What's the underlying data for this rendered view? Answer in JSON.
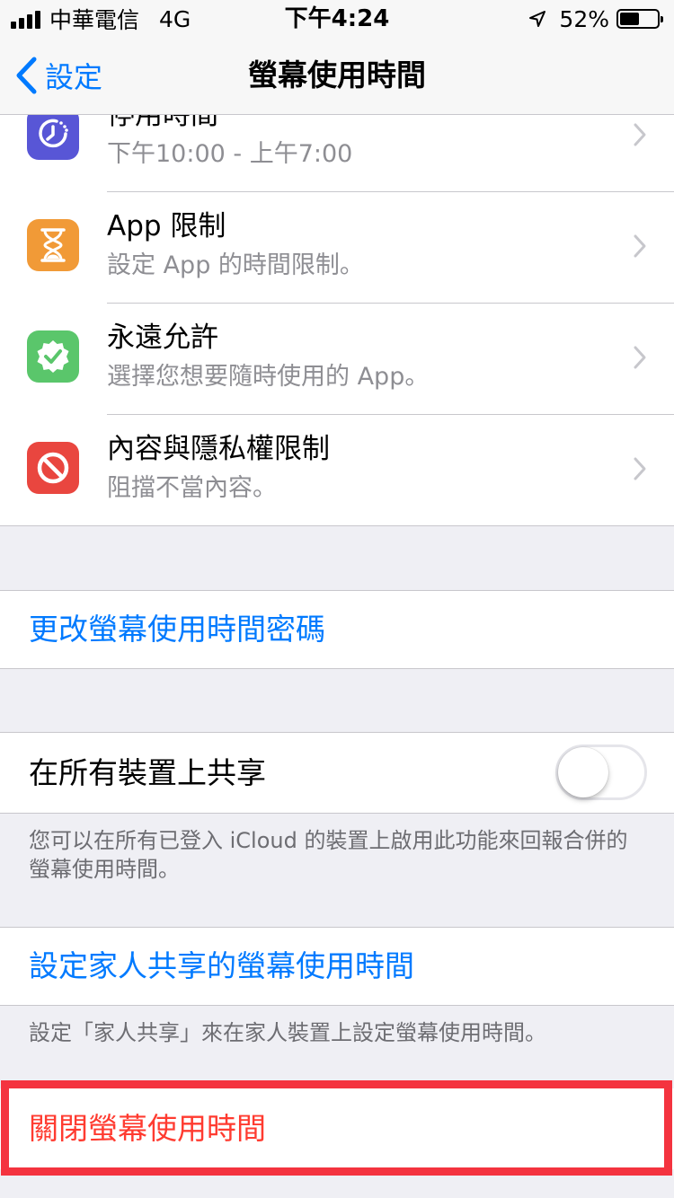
{
  "status_bar": {
    "carrier": "中華電信",
    "network": "4G",
    "time": "下午4:24",
    "battery_percent": "52%",
    "battery_level": 0.52
  },
  "nav": {
    "back_label": "設定",
    "title": "螢幕使用時間"
  },
  "rows": [
    {
      "title": "停用時間",
      "subtitle": "下午10:00 - 上午7:00",
      "icon": "downtime-icon",
      "color": "#5856d6"
    },
    {
      "title": "App 限制",
      "subtitle": "設定 App 的時間限制。",
      "icon": "hourglass-icon",
      "color": "#f19a37"
    },
    {
      "title": "永遠允許",
      "subtitle": "選擇您想要隨時使用的 App。",
      "icon": "checkmark-seal-icon",
      "color": "#5ac66b"
    },
    {
      "title": "內容與隱私權限制",
      "subtitle": "阻擋不當內容。",
      "icon": "prohibited-icon",
      "color": "#e9463f"
    }
  ],
  "change_passcode_label": "更改螢幕使用時間密碼",
  "share_across_devices": {
    "label": "在所有裝置上共享",
    "enabled": false,
    "footer": "您可以在所有已登入 iCloud 的裝置上啟用此功能來回報合併的螢幕使用時間。"
  },
  "family_sharing": {
    "label": "設定家人共享的螢幕使用時間",
    "footer": "設定「家人共享」來在家人裝置上設定螢幕使用時間。"
  },
  "turn_off_label": "關閉螢幕使用時間",
  "colors": {
    "accent": "#007aff",
    "destructive": "#ff3b30",
    "highlight": "#f4333f"
  }
}
